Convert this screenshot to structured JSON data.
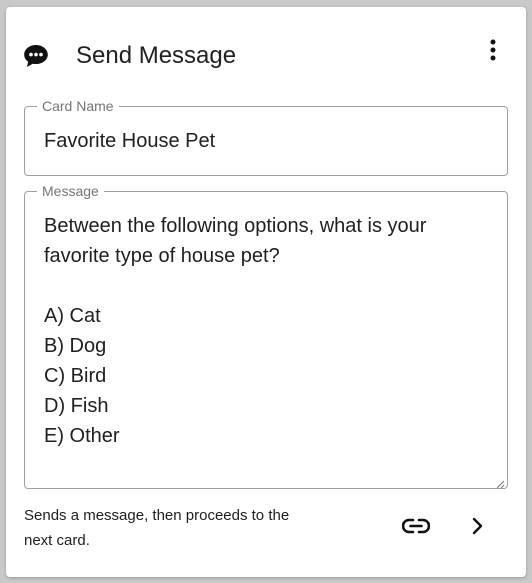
{
  "card": {
    "icon": "chat-bubble-icon",
    "title": "Send Message",
    "menu_icon": "more-vertical-icon"
  },
  "fields": {
    "card_name": {
      "label": "Card Name",
      "value": "Favorite House Pet"
    },
    "message": {
      "label": "Message",
      "value": "Between the following options, what is your favorite type of house pet?\n\nA) Cat\nB) Dog\nC) Bird\nD) Fish\nE) Other"
    }
  },
  "footer": {
    "description": "Sends a message, then proceeds to the next card.",
    "link_icon": "link-icon",
    "next_icon": "chevron-right-icon"
  }
}
